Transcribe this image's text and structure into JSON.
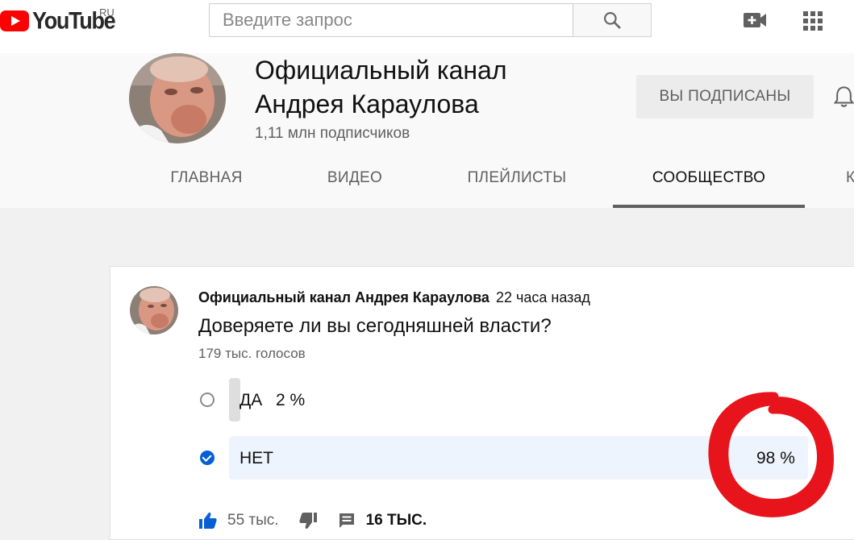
{
  "header": {
    "logo_text": "YouTube",
    "region": "RU",
    "search_placeholder": "Введите запрос",
    "search_value": "",
    "icons": [
      "search-icon",
      "video-camera-add-icon",
      "apps-grid-icon"
    ]
  },
  "channel": {
    "title": "Официальный канал Андрея Караулова",
    "subscribers": "1,11 млн подписчиков",
    "subscribe_label": "ВЫ ПОДПИСАНЫ",
    "bell_icon": "bell-icon",
    "tabs": [
      {
        "label": "ГЛАВНАЯ",
        "active": false
      },
      {
        "label": "ВИДЕО",
        "active": false
      },
      {
        "label": "ПЛЕЙЛИСТЫ",
        "active": false
      },
      {
        "label": "СООБЩЕСТВО",
        "active": true
      },
      {
        "label": "К",
        "active": false
      }
    ]
  },
  "post": {
    "author": "Официальный канал Андрея Караулова",
    "time": "22 часа назад",
    "question": "Доверяете ли вы сегодняшней власти?",
    "votes": "179 тыс. голосов",
    "options": [
      {
        "label": "ДА",
        "percent_text": "2 %",
        "percent": 2,
        "selected": false
      },
      {
        "label": "НЕТ",
        "percent_text": "98 %",
        "percent": 98,
        "selected": true
      }
    ],
    "likes": "55 тыс.",
    "comments": "16 ТЫС."
  },
  "colors": {
    "accent_blue": "#065fd4",
    "logo_red": "#ff0000",
    "annotation_red": "#e8141c",
    "selected_bar": "#eef4fd",
    "unselected_bar": "#dedede"
  }
}
